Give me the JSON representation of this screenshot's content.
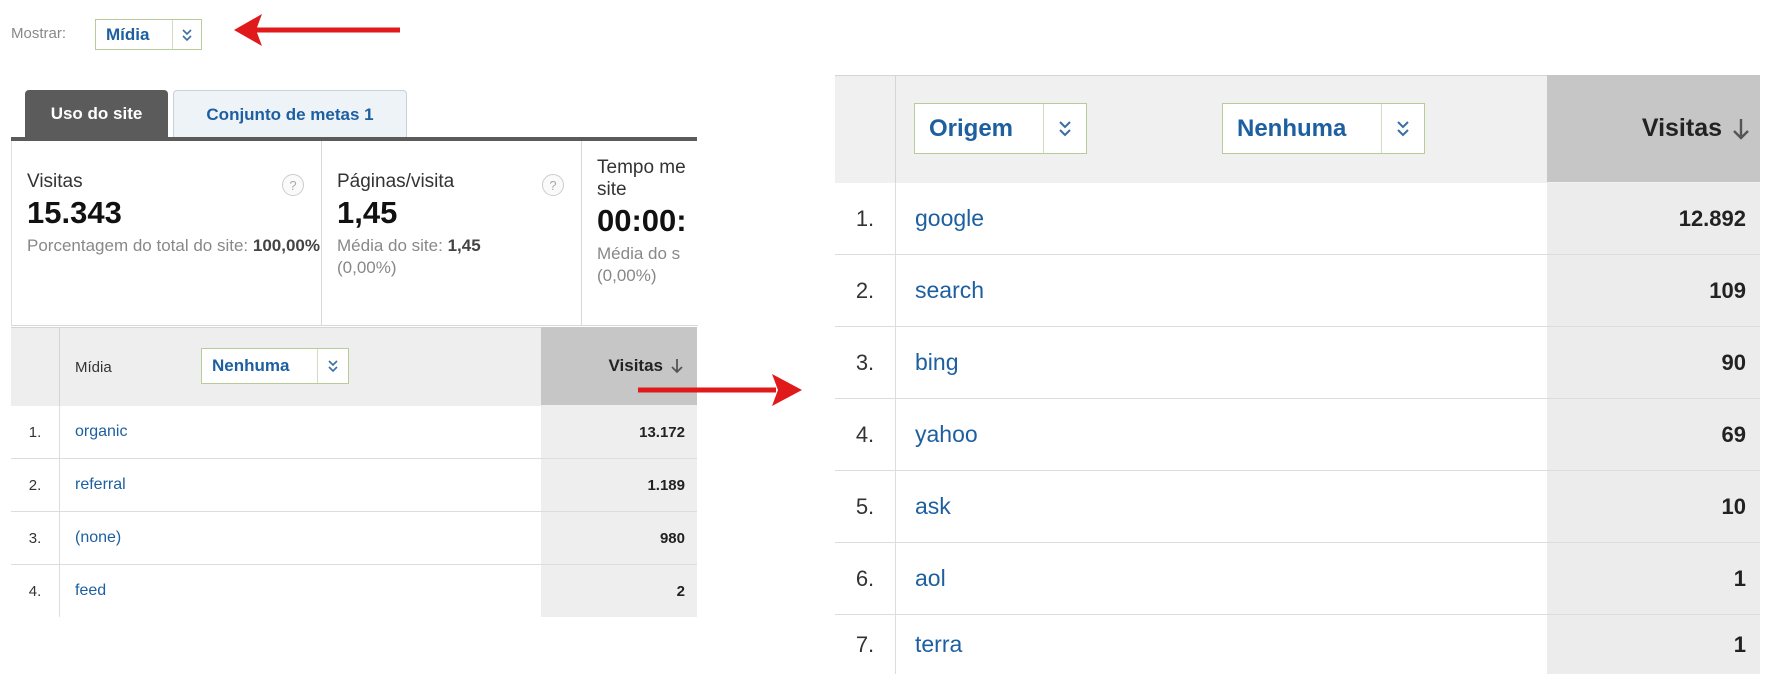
{
  "show": {
    "label": "Mostrar:",
    "value": "Mídia"
  },
  "tabs": [
    {
      "label": "Uso do site",
      "active": true
    },
    {
      "label": "Conjunto de metas 1",
      "active": false
    }
  ],
  "scorecards": [
    {
      "title": "Visitas",
      "value": "15.343",
      "sub_label": "Porcentagem do total do site:",
      "sub_value": "100,00%"
    },
    {
      "title": "Páginas/visita",
      "value": "1,45",
      "sub_label": "Média do site:",
      "sub_value": "1,45",
      "sub_extra": "(0,00%)"
    },
    {
      "title": "Tempo me",
      "title2": "site",
      "value": "00:00:",
      "sub_label": "Média do s",
      "sub_extra": "(0,00%)"
    }
  ],
  "left_table": {
    "dimension_label": "Mídia",
    "secondary_dimension": "Nenhuma",
    "metric_label": "Visitas",
    "rows": [
      {
        "num": "1.",
        "label": "organic",
        "value": "13.172"
      },
      {
        "num": "2.",
        "label": "referral",
        "value": "1.189"
      },
      {
        "num": "3.",
        "label": "(none)",
        "value": "980"
      },
      {
        "num": "4.",
        "label": "feed",
        "value": "2"
      }
    ]
  },
  "right_table": {
    "primary_dimension": "Origem",
    "secondary_dimension": "Nenhuma",
    "metric_label": "Visitas",
    "rows": [
      {
        "num": "1.",
        "label": "google",
        "value": "12.892"
      },
      {
        "num": "2.",
        "label": "search",
        "value": "109"
      },
      {
        "num": "3.",
        "label": "bing",
        "value": "90"
      },
      {
        "num": "4.",
        "label": "yahoo",
        "value": "69"
      },
      {
        "num": "5.",
        "label": "ask",
        "value": "10"
      },
      {
        "num": "6.",
        "label": "aol",
        "value": "1"
      },
      {
        "num": "7.",
        "label": "terra",
        "value": "1"
      }
    ]
  },
  "icons": {
    "dropdown": "chevron-double-down-icon",
    "help": "question-mark-icon",
    "sort": "arrow-down-icon",
    "annotation_arrows": "red-arrow-icon"
  },
  "colors": {
    "link": "#1d5fa0",
    "annotation": "#e0191b",
    "tab_active": "#5b5b5b"
  }
}
